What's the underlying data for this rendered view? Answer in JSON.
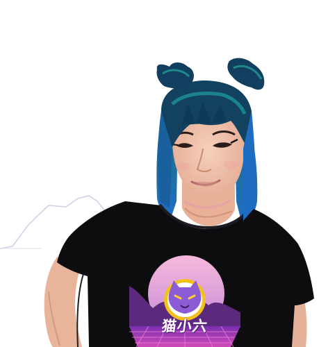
{
  "photo": {
    "subject": "person-blue-hair-cutout",
    "colors": {
      "background": "#ffffff",
      "hair_dark": "#10365a",
      "hair_blue": "#1f6fc8",
      "hair_teal": "#1c8c86",
      "skin": "#f0c3ad",
      "skin_shade": "#d9a48b",
      "shirt": "#0c0c0e",
      "graphic_sun_top": "#f4b1d8",
      "graphic_sun_bottom": "#c98bd8",
      "graphic_mountain": "#6b2f8f",
      "graphic_grid": "#e84fc2",
      "cat_face": "#8b5cd6",
      "cat_ring": "#f2c21a"
    },
    "shirt_graphic": {
      "text": "猫小六",
      "icon": "cat-face-icon"
    }
  }
}
